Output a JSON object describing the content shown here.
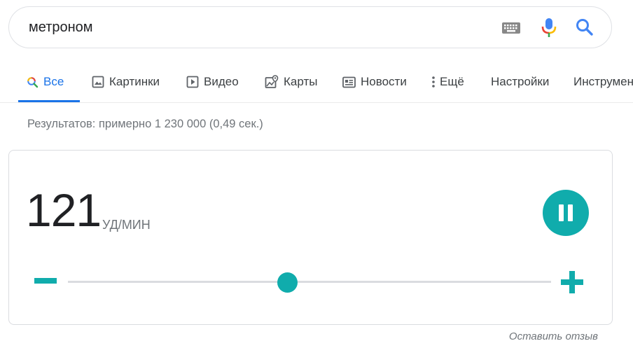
{
  "search": {
    "query": "метроном",
    "icons": {
      "keyboard": "keyboard-icon",
      "mic": "mic-icon",
      "search": "search-icon"
    },
    "colors": {
      "blue": "#4285f4",
      "red": "#ea4335",
      "yellow": "#fbbc05",
      "green": "#34a853"
    }
  },
  "tabs": [
    {
      "label": "Все",
      "icon": "search-icon",
      "active": true
    },
    {
      "label": "Картинки",
      "icon": "image-icon"
    },
    {
      "label": "Видео",
      "icon": "play-icon"
    },
    {
      "label": "Карты",
      "icon": "map-icon"
    },
    {
      "label": "Новости",
      "icon": "news-icon"
    },
    {
      "label": "Ещё",
      "icon": "more-vert-icon"
    },
    {
      "label": "Настройки"
    },
    {
      "label": "Инструменты"
    }
  ],
  "result_stats": "Результатов: примерно 1 230 000 (0,49 сек.)",
  "metronome": {
    "bpm": "121",
    "unit": "УД/МИН",
    "state": "playing",
    "slider_fraction": 0.455,
    "accent_color": "#10acac"
  },
  "feedback": "Оставить отзыв"
}
